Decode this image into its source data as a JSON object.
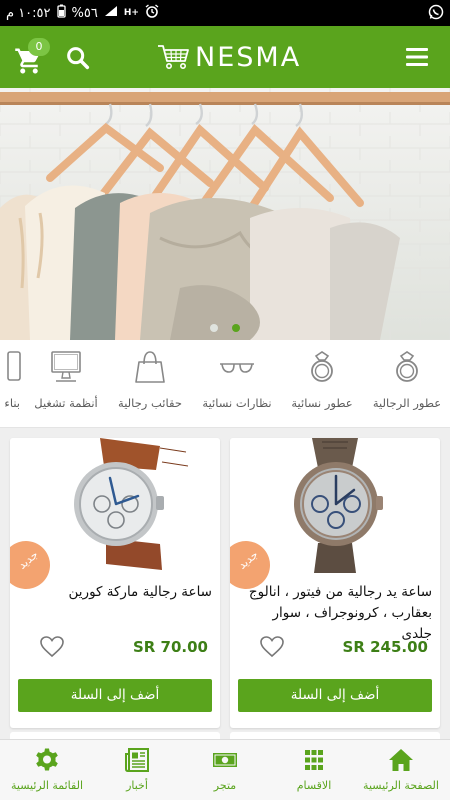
{
  "status_bar": {
    "time": "١٠:٥٢ م",
    "battery": "%٥٦",
    "network": "H+",
    "icons": [
      "alarm-icon",
      "signal-icon",
      "network-h-plus-icon",
      "battery-icon",
      "whatsapp-icon"
    ]
  },
  "app_bar": {
    "logo_text": "NESMA",
    "cart_count": "0",
    "icons": [
      "cart-icon",
      "search-icon",
      "menu-icon"
    ],
    "color": "#5aa41d"
  },
  "banner": {
    "slides": 2,
    "active_slide": 2
  },
  "categories": [
    {
      "label": "عطور الرجالية",
      "icon": "ring-icon"
    },
    {
      "label": "عطور نسائية",
      "icon": "ring-icon"
    },
    {
      "label": "نظارات نسائية",
      "icon": "glasses-icon"
    },
    {
      "label": "حقائب رجالية",
      "icon": "bag-icon"
    },
    {
      "label": "أنظمة تشغيل",
      "icon": "monitor-icon"
    },
    {
      "label": "بناء",
      "icon": "phone-icon"
    }
  ],
  "products": [
    {
      "title": "ساعة يد رجالية من فيتور ، انالوج بعقارب ، كرونوجراف ، سوار جلدى",
      "price": "SR 245.00",
      "badge": "جديد",
      "button": "أضف إلى السلة"
    },
    {
      "title": "ساعة رجالية ماركة كورين",
      "price": "SR 70.00",
      "badge": "جديد",
      "button": "أضف إلى السلة"
    }
  ],
  "bottom_nav": [
    {
      "label": "الصفحة الرئيسية",
      "icon": "home-icon"
    },
    {
      "label": "الاقسام",
      "icon": "grid-icon"
    },
    {
      "label": "متجر",
      "icon": "money-icon"
    },
    {
      "label": "أخبار",
      "icon": "newspaper-icon"
    },
    {
      "label": "القائمة الرئيسية",
      "icon": "gear-icon"
    }
  ],
  "colors": {
    "primary": "#5aa41d",
    "price": "#3d7f16",
    "badge": "#f3a370"
  }
}
